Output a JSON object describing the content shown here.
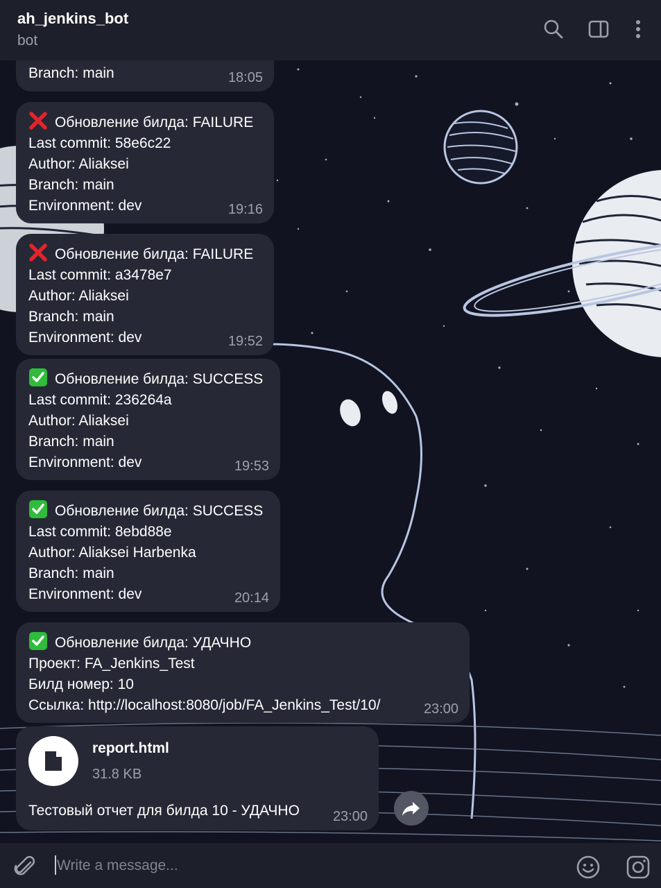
{
  "header": {
    "title": "ah_jenkins_bot",
    "subtitle": "bot",
    "icons": [
      "search-icon",
      "sidebar-panel-icon",
      "more-vertical-icon"
    ]
  },
  "messages": [
    {
      "lines": [
        "Branch: main"
      ],
      "time": "18:05"
    },
    {
      "status_icon": "cross-mark-emoji",
      "lines": [
        "Обновление билда: FAILURE",
        "Last commit: 58e6c22",
        "Author: Aliaksei",
        "Branch: main",
        "Environment: dev"
      ],
      "time": "19:16"
    },
    {
      "status_icon": "cross-mark-emoji",
      "lines": [
        "Обновление билда: FAILURE",
        "Last commit: a3478e7",
        "Author: Aliaksei",
        "Branch: main",
        "Environment: dev"
      ],
      "time": "19:52"
    },
    {
      "status_icon": "check-mark-emoji",
      "lines": [
        "Обновление билда: SUCCESS",
        "Last commit: 236264a",
        "Author: Aliaksei",
        "Branch: main",
        "Environment: dev"
      ],
      "time": "19:53"
    },
    {
      "status_icon": "check-mark-emoji",
      "lines": [
        "Обновление билда: SUCCESS",
        "Last commit: 8ebd88e",
        "Author: Aliaksei Harbenka",
        "Branch: main",
        "Environment: dev"
      ],
      "time": "20:14"
    },
    {
      "status_icon": "check-mark-emoji",
      "lines": [
        "Обновление билда: УДАЧНО",
        "Проект: FA_Jenkins_Test",
        "Билд номер: 10",
        "Ссылка: http://localhost:8080/job/FA_Jenkins_Test/10/"
      ],
      "time": "23:00"
    }
  ],
  "file_message": {
    "file_name": "report.html",
    "file_size": "31.8 KB",
    "caption": "Тестовый отчет для билда 10 - УДАЧНО",
    "time": "23:00"
  },
  "composer": {
    "placeholder": "Write a message...",
    "icons": [
      "attach-icon",
      "emoji-icon",
      "sticker-icon"
    ]
  },
  "colors": {
    "header_bg": "#1d1f2b",
    "bubble_bg": "#262935",
    "wallpaper_bg": "#111420",
    "failure_red": "#e3242b",
    "success_green": "#2fbb3b"
  }
}
